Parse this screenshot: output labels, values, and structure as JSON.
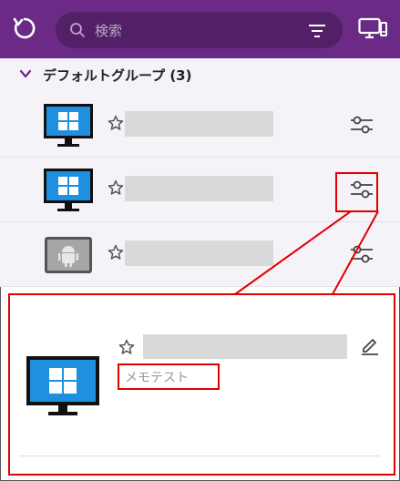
{
  "search": {
    "placeholder": "検索"
  },
  "group": {
    "title": "デフォルトグループ (3)"
  },
  "devices": [
    {
      "os": "windows",
      "favorite": false
    },
    {
      "os": "windows",
      "favorite": false
    },
    {
      "os": "android",
      "favorite": false
    }
  ],
  "detail": {
    "os": "windows",
    "memo": "メモテスト"
  },
  "colors": {
    "topbar": "#6b2a86",
    "search_bg": "#532068",
    "highlight": "#e00000",
    "list_bg": "#f5f3f8"
  },
  "icons": {
    "refresh": "refresh-icon",
    "search": "search-icon",
    "filter": "filter-icon",
    "device": "device-list-icon",
    "chevron": "chevron-down-icon",
    "star": "star-icon",
    "settings": "sliders-icon",
    "edit": "pencil-icon"
  }
}
